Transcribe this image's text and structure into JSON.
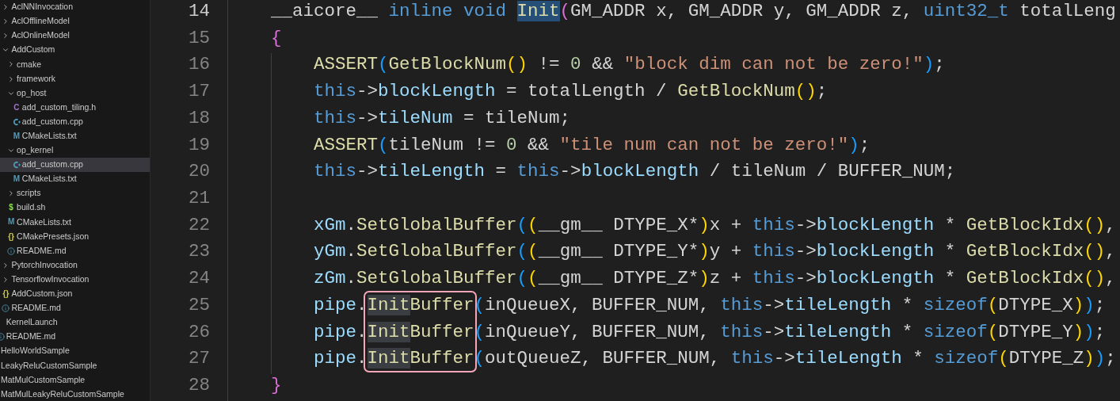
{
  "explorer": {
    "tree": [
      {
        "children": [
          {
            "children": [
              {
                "label": "AclNNInvocation",
                "kind": "folder",
                "expanded": false,
                "selected": false
              },
              {
                "label": "AclOfflineModel",
                "kind": "folder",
                "expanded": false,
                "selected": false
              },
              {
                "label": "AclOnlineModel",
                "kind": "folder",
                "expanded": false,
                "selected": false
              },
              {
                "label": "AddCustom",
                "kind": "folder",
                "expanded": true,
                "selected": false,
                "children": [
                  {
                    "label": "cmake",
                    "kind": "folder",
                    "expanded": false,
                    "selected": false
                  },
                  {
                    "label": "framework",
                    "kind": "folder",
                    "expanded": false,
                    "selected": false
                  },
                  {
                    "label": "op_host",
                    "kind": "folder",
                    "expanded": true,
                    "selected": false,
                    "children": [
                      {
                        "label": "add_custom_tiling.h",
                        "kind": "c-header",
                        "icon": "C",
                        "selected": false
                      },
                      {
                        "label": "add_custom.cpp",
                        "kind": "cpp",
                        "selected": false
                      },
                      {
                        "label": "CMakeLists.txt",
                        "kind": "cmake",
                        "icon": "M",
                        "selected": false
                      }
                    ]
                  },
                  {
                    "label": "op_kernel",
                    "kind": "folder",
                    "expanded": true,
                    "selected": false,
                    "children": [
                      {
                        "label": "add_custom.cpp",
                        "kind": "cpp",
                        "selected": true
                      },
                      {
                        "label": "CMakeLists.txt",
                        "kind": "cmake",
                        "icon": "M",
                        "selected": false
                      }
                    ]
                  },
                  {
                    "label": "scripts",
                    "kind": "folder",
                    "expanded": false,
                    "selected": false
                  },
                  {
                    "label": "build.sh",
                    "kind": "shell",
                    "icon": "$",
                    "selected": false
                  },
                  {
                    "label": "CMakeLists.txt",
                    "kind": "cmake",
                    "icon": "M",
                    "selected": false
                  },
                  {
                    "label": "CMakePresets.json",
                    "kind": "json",
                    "icon": "{}",
                    "selected": false
                  },
                  {
                    "label": "README.md",
                    "kind": "readme",
                    "selected": false
                  }
                ]
              },
              {
                "label": "PytorchInvocation",
                "kind": "folder",
                "expanded": false,
                "selected": false
              },
              {
                "label": "TensorflowInvocation",
                "kind": "folder",
                "expanded": false,
                "selected": false
              },
              {
                "label": "AddCustom.json",
                "kind": "json",
                "icon": "{}",
                "selected": false
              },
              {
                "label": "README.md",
                "kind": "readme",
                "selected": false
              }
            ]
          },
          {
            "label": "KernelLaunch",
            "selected": false
          },
          {
            "label": "README.md",
            "kind": "readme",
            "selected": false
          }
        ]
      },
      {
        "label": "HelloWorldSample",
        "selected": false
      },
      {
        "label": "LeakyReluCustomSample",
        "selected": false
      },
      {
        "label": "MatMulCustomSample",
        "selected": false
      },
      {
        "label": "MatMulLeakyReluCustomSample",
        "selected": false
      }
    ]
  },
  "editor": {
    "lines": [
      {
        "number": "14",
        "current": true,
        "tokens": [
          {
            "text": "    __aicore__ ",
            "kind": "plain"
          },
          {
            "text": "inline void ",
            "kind": "keyword"
          },
          {
            "text": "Init",
            "kind": "function",
            "selected": true
          },
          {
            "text": "(",
            "kind": "bracket-pink"
          },
          {
            "text": "GM_ADDR x, GM_ADDR y, GM_ADDR z, ",
            "kind": "plain"
          },
          {
            "text": "uint32_t",
            "kind": "keyword"
          },
          {
            "text": " totalLeng",
            "kind": "plain"
          }
        ]
      },
      {
        "number": "15",
        "current": false,
        "tokens": [
          {
            "text": "    {",
            "kind": "bracket-pink"
          }
        ]
      },
      {
        "number": "16",
        "current": false,
        "tokens": [
          {
            "text": "        ASSERT",
            "kind": "function"
          },
          {
            "text": "(",
            "kind": "bracket-blue"
          },
          {
            "text": "GetBlockNum",
            "kind": "function"
          },
          {
            "text": "()",
            "kind": "bracket-gold"
          },
          {
            "text": " != ",
            "kind": "plain"
          },
          {
            "text": "0",
            "kind": "number"
          },
          {
            "text": " && ",
            "kind": "plain"
          },
          {
            "text": "\"block dim can not be zero!\"",
            "kind": "string"
          },
          {
            "text": ")",
            "kind": "bracket-blue"
          },
          {
            "text": ";",
            "kind": "plain"
          }
        ]
      },
      {
        "number": "17",
        "current": false,
        "tokens": [
          {
            "text": "        this",
            "kind": "keyword"
          },
          {
            "text": "->",
            "kind": "plain"
          },
          {
            "text": "blockLength",
            "kind": "variable"
          },
          {
            "text": " = totalLength / ",
            "kind": "plain"
          },
          {
            "text": "GetBlockNum",
            "kind": "function"
          },
          {
            "text": "()",
            "kind": "bracket-gold"
          },
          {
            "text": ";",
            "kind": "plain"
          }
        ]
      },
      {
        "number": "18",
        "current": false,
        "tokens": [
          {
            "text": "        this",
            "kind": "keyword"
          },
          {
            "text": "->",
            "kind": "plain"
          },
          {
            "text": "tileNum",
            "kind": "variable"
          },
          {
            "text": " = tileNum;",
            "kind": "plain"
          }
        ]
      },
      {
        "number": "19",
        "current": false,
        "tokens": [
          {
            "text": "        ASSERT",
            "kind": "function"
          },
          {
            "text": "(",
            "kind": "bracket-blue"
          },
          {
            "text": "tileNum != ",
            "kind": "plain"
          },
          {
            "text": "0",
            "kind": "number"
          },
          {
            "text": " && ",
            "kind": "plain"
          },
          {
            "text": "\"tile num can not be zero!\"",
            "kind": "string"
          },
          {
            "text": ")",
            "kind": "bracket-blue"
          },
          {
            "text": ";",
            "kind": "plain"
          }
        ]
      },
      {
        "number": "20",
        "current": false,
        "tokens": [
          {
            "text": "        this",
            "kind": "keyword"
          },
          {
            "text": "->",
            "kind": "plain"
          },
          {
            "text": "tileLength",
            "kind": "variable"
          },
          {
            "text": " = ",
            "kind": "plain"
          },
          {
            "text": "this",
            "kind": "keyword"
          },
          {
            "text": "->",
            "kind": "plain"
          },
          {
            "text": "blockLength",
            "kind": "variable"
          },
          {
            "text": " / tileNum / BUFFER_NUM;",
            "kind": "plain"
          }
        ]
      },
      {
        "number": "21",
        "current": false
      },
      {
        "number": "22",
        "current": false,
        "tokens": [
          {
            "text": "        xGm",
            "kind": "variable"
          },
          {
            "text": ".",
            "kind": "plain"
          },
          {
            "text": "SetGlobalBuffer",
            "kind": "function"
          },
          {
            "text": "(",
            "kind": "bracket-blue"
          },
          {
            "text": "(",
            "kind": "bracket-gold"
          },
          {
            "text": "__gm__ DTYPE_X*",
            "kind": "plain"
          },
          {
            "text": ")",
            "kind": "bracket-gold"
          },
          {
            "text": "x + ",
            "kind": "plain"
          },
          {
            "text": "this",
            "kind": "keyword"
          },
          {
            "text": "->",
            "kind": "plain"
          },
          {
            "text": "blockLength",
            "kind": "variable"
          },
          {
            "text": " * ",
            "kind": "plain"
          },
          {
            "text": "GetBlockIdx",
            "kind": "function"
          },
          {
            "text": "()",
            "kind": "bracket-gold"
          },
          {
            "text": ",",
            "kind": "plain"
          }
        ]
      },
      {
        "number": "23",
        "current": false,
        "tokens": [
          {
            "text": "        yGm",
            "kind": "variable"
          },
          {
            "text": ".",
            "kind": "plain"
          },
          {
            "text": "SetGlobalBuffer",
            "kind": "function"
          },
          {
            "text": "(",
            "kind": "bracket-blue"
          },
          {
            "text": "(",
            "kind": "bracket-gold"
          },
          {
            "text": "__gm__ DTYPE_Y*",
            "kind": "plain"
          },
          {
            "text": ")",
            "kind": "bracket-gold"
          },
          {
            "text": "y + ",
            "kind": "plain"
          },
          {
            "text": "this",
            "kind": "keyword"
          },
          {
            "text": "->",
            "kind": "plain"
          },
          {
            "text": "blockLength",
            "kind": "variable"
          },
          {
            "text": " * ",
            "kind": "plain"
          },
          {
            "text": "GetBlockIdx",
            "kind": "function"
          },
          {
            "text": "()",
            "kind": "bracket-gold"
          },
          {
            "text": ",",
            "kind": "plain"
          }
        ]
      },
      {
        "number": "24",
        "current": false,
        "tokens": [
          {
            "text": "        zGm",
            "kind": "variable"
          },
          {
            "text": ".",
            "kind": "plain"
          },
          {
            "text": "SetGlobalBuffer",
            "kind": "function"
          },
          {
            "text": "(",
            "kind": "bracket-blue"
          },
          {
            "text": "(",
            "kind": "bracket-gold"
          },
          {
            "text": "__gm__ DTYPE_Z*",
            "kind": "plain"
          },
          {
            "text": ")",
            "kind": "bracket-gold"
          },
          {
            "text": "z + ",
            "kind": "plain"
          },
          {
            "text": "this",
            "kind": "keyword"
          },
          {
            "text": "->",
            "kind": "plain"
          },
          {
            "text": "blockLength",
            "kind": "variable"
          },
          {
            "text": " * ",
            "kind": "plain"
          },
          {
            "text": "GetBlockIdx",
            "kind": "function"
          },
          {
            "text": "()",
            "kind": "bracket-gold"
          },
          {
            "text": ",",
            "kind": "plain"
          }
        ]
      },
      {
        "number": "25",
        "current": false,
        "tokens": [
          {
            "text": "        pipe",
            "kind": "variable"
          },
          {
            "text": ".",
            "kind": "plain"
          },
          {
            "text": "Init",
            "kind": "function",
            "highlighted": true,
            "boxed": true
          },
          {
            "text": "Buffer",
            "kind": "function",
            "boxed": true
          },
          {
            "text": "(",
            "kind": "bracket-blue"
          },
          {
            "text": "inQueueX, BUFFER_NUM, ",
            "kind": "plain"
          },
          {
            "text": "this",
            "kind": "keyword"
          },
          {
            "text": "->",
            "kind": "plain"
          },
          {
            "text": "tileLength",
            "kind": "variable"
          },
          {
            "text": " * ",
            "kind": "plain"
          },
          {
            "text": "sizeof",
            "kind": "keyword"
          },
          {
            "text": "(",
            "kind": "bracket-gold"
          },
          {
            "text": "DTYPE_X",
            "kind": "plain"
          },
          {
            "text": ")",
            "kind": "bracket-gold"
          },
          {
            "text": ")",
            "kind": "bracket-blue"
          },
          {
            "text": ";",
            "kind": "plain"
          }
        ]
      },
      {
        "number": "26",
        "current": false,
        "tokens": [
          {
            "text": "        pipe",
            "kind": "variable"
          },
          {
            "text": ".",
            "kind": "plain"
          },
          {
            "text": "Init",
            "kind": "function",
            "highlighted": true,
            "boxed": true
          },
          {
            "text": "Buffer",
            "kind": "function",
            "boxed": true
          },
          {
            "text": "(",
            "kind": "bracket-blue"
          },
          {
            "text": "inQueueY, BUFFER_NUM, ",
            "kind": "plain"
          },
          {
            "text": "this",
            "kind": "keyword"
          },
          {
            "text": "->",
            "kind": "plain"
          },
          {
            "text": "tileLength",
            "kind": "variable"
          },
          {
            "text": " * ",
            "kind": "plain"
          },
          {
            "text": "sizeof",
            "kind": "keyword"
          },
          {
            "text": "(",
            "kind": "bracket-gold"
          },
          {
            "text": "DTYPE_Y",
            "kind": "plain"
          },
          {
            "text": ")",
            "kind": "bracket-gold"
          },
          {
            "text": ")",
            "kind": "bracket-blue"
          },
          {
            "text": ";",
            "kind": "plain"
          }
        ]
      },
      {
        "number": "27",
        "current": false,
        "tokens": [
          {
            "text": "        pipe",
            "kind": "variable"
          },
          {
            "text": ".",
            "kind": "plain"
          },
          {
            "text": "Init",
            "kind": "function",
            "highlighted": true,
            "boxed": true
          },
          {
            "text": "Buffer",
            "kind": "function",
            "boxed": true
          },
          {
            "text": "(",
            "kind": "bracket-blue"
          },
          {
            "text": "outQueueZ, BUFFER_NUM, ",
            "kind": "plain"
          },
          {
            "text": "this",
            "kind": "keyword"
          },
          {
            "text": "->",
            "kind": "plain"
          },
          {
            "text": "tileLength",
            "kind": "variable"
          },
          {
            "text": " * ",
            "kind": "plain"
          },
          {
            "text": "sizeof",
            "kind": "keyword"
          },
          {
            "text": "(",
            "kind": "bracket-gold"
          },
          {
            "text": "DTYPE_Z",
            "kind": "plain"
          },
          {
            "text": ")",
            "kind": "bracket-gold"
          },
          {
            "text": ")",
            "kind": "bracket-blue"
          },
          {
            "text": ";",
            "kind": "plain"
          }
        ]
      },
      {
        "number": "28",
        "current": false,
        "tokens": [
          {
            "text": "    }",
            "kind": "bracket-pink"
          }
        ]
      }
    ]
  }
}
